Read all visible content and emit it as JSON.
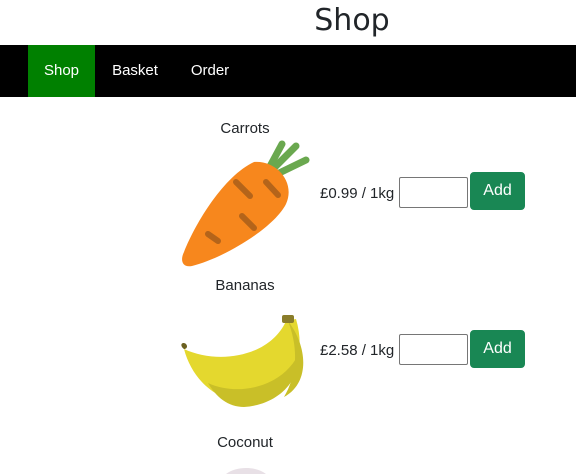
{
  "page": {
    "title": "Shop"
  },
  "nav": {
    "items": [
      {
        "label": "Shop",
        "active": true
      },
      {
        "label": "Basket",
        "active": false
      },
      {
        "label": "Order",
        "active": false
      }
    ]
  },
  "products": [
    {
      "name": "Carrots",
      "price": "£0.99 / 1kg",
      "quantity": "",
      "add_label": "Add",
      "icon": "carrot-icon"
    },
    {
      "name": "Bananas",
      "price": "£2.58 / 1kg",
      "quantity": "",
      "add_label": "Add",
      "icon": "banana-icon"
    },
    {
      "name": "Coconut",
      "icon": "coconut-icon"
    }
  ],
  "colors": {
    "nav_bg": "#000000",
    "nav_active": "#008000",
    "button": "#198754"
  }
}
